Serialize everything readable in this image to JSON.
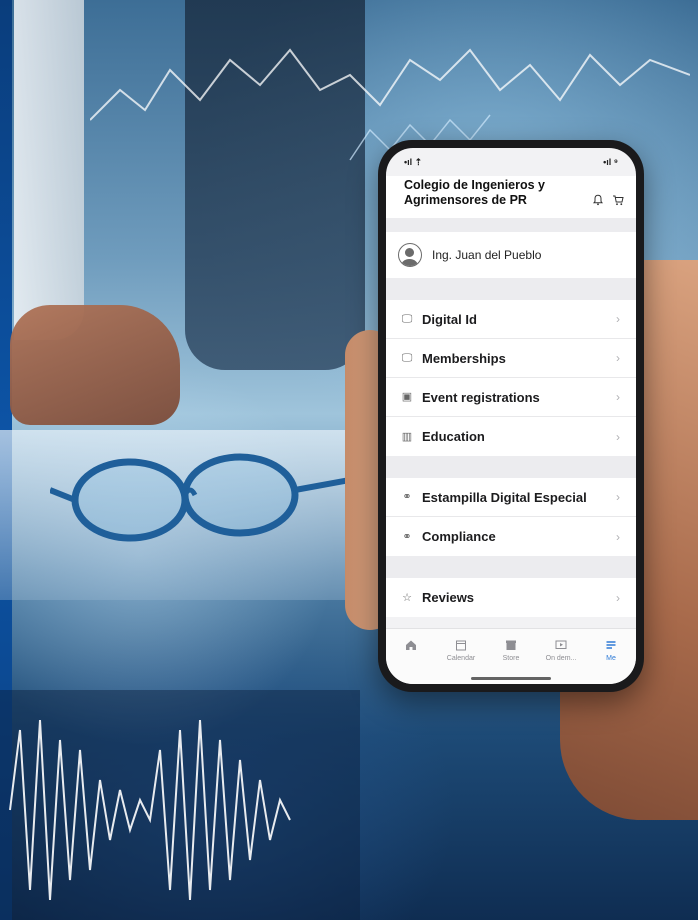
{
  "status_bar": {
    "signal": "•ıl ⇡",
    "battery": "•ıl ⁹"
  },
  "header": {
    "org_name": "Colegio de Ingenieros y Agrimensores de PR",
    "icons": [
      "bell-icon",
      "cart-icon"
    ]
  },
  "profile": {
    "name": "Ing. Juan del Pueblo",
    "icon": "user-circle-icon"
  },
  "menu_group_1": [
    {
      "label": "Digital Id",
      "icon": "monitor-icon"
    },
    {
      "label": "Memberships",
      "icon": "monitor-icon"
    },
    {
      "label": "Event registrations",
      "icon": "calendar-icon"
    },
    {
      "label": "Education",
      "icon": "library-icon"
    }
  ],
  "menu_group_2": [
    {
      "label": "Estampilla Digital Especial",
      "icon": "link-icon"
    },
    {
      "label": "Compliance",
      "icon": "link-icon"
    }
  ],
  "menu_group_3": [
    {
      "label": "Reviews",
      "icon": "star-icon"
    }
  ],
  "tabbar": [
    {
      "label": "",
      "icon": "home-icon",
      "active": false
    },
    {
      "label": "Calendar",
      "icon": "calendar-icon",
      "active": false
    },
    {
      "label": "Store",
      "icon": "store-icon",
      "active": false
    },
    {
      "label": "On dem...",
      "icon": "video-icon",
      "active": false
    },
    {
      "label": "Me",
      "icon": "menu-icon",
      "active": true
    }
  ],
  "colors": {
    "accent": "#2f7bd6",
    "phone_frame": "#1a1a1c"
  }
}
